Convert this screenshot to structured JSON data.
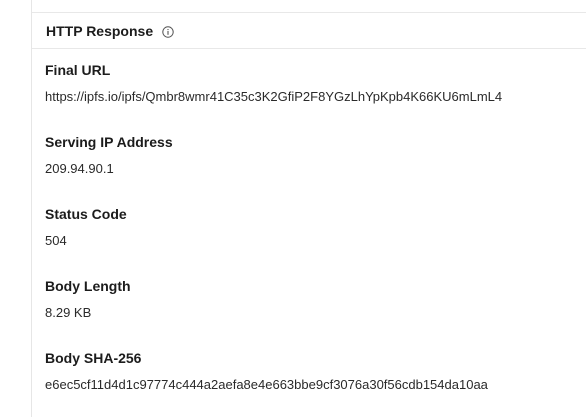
{
  "section": {
    "title": "HTTP Response",
    "info_icon": "info-circle-icon"
  },
  "fields": [
    {
      "label": "Final URL",
      "value": "https://ipfs.io/ipfs/Qmbr8wmr41C35c3K2GfiP2F8YGzLhYpKpb4K66KU6mLmL4"
    },
    {
      "label": "Serving IP Address",
      "value": "209.94.90.1"
    },
    {
      "label": "Status Code",
      "value": "504"
    },
    {
      "label": "Body Length",
      "value": "8.29 KB"
    },
    {
      "label": "Body SHA-256",
      "value": "e6ec5cf11d4d1c97774c444a2aefa8e4e663bbe9cf3076a30f56cdb154da10aa"
    }
  ]
}
